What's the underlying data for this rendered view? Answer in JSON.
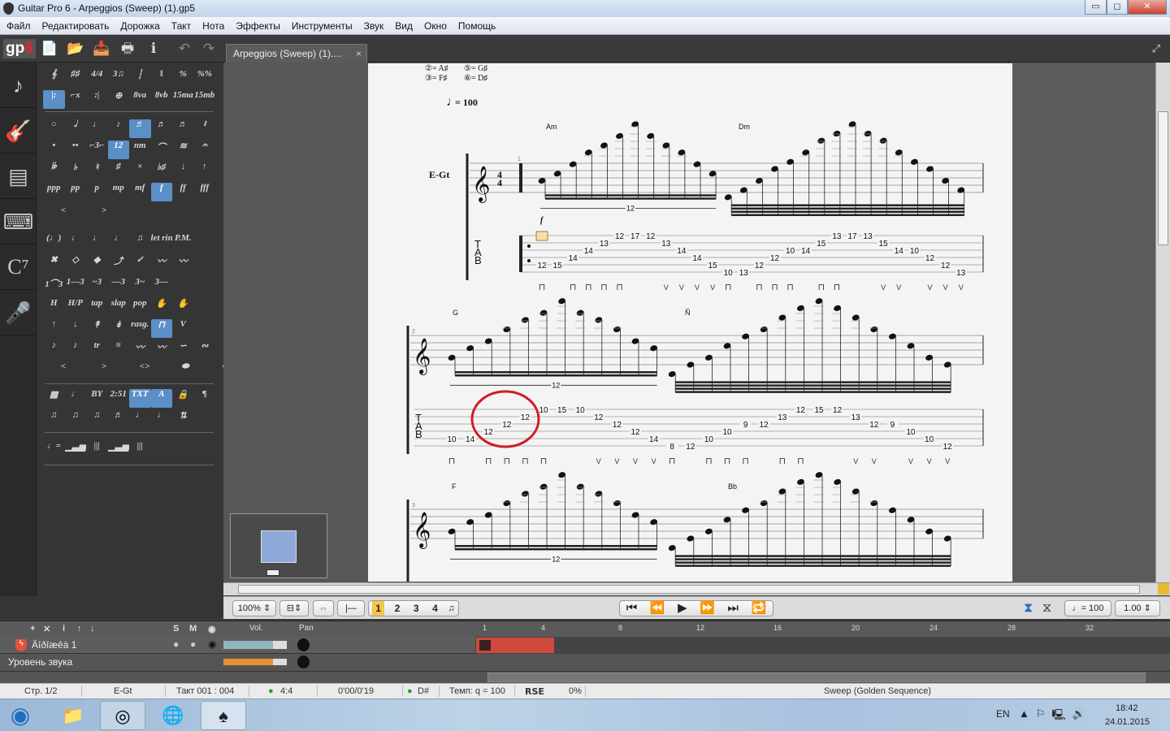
{
  "window": {
    "title": "Guitar Pro 6 - Arpeggios (Sweep) (1).gp5",
    "minimize": "▭",
    "maximize": "◻",
    "close": "✕"
  },
  "menu": [
    "Файл",
    "Редактировать",
    "Дорожка",
    "Такт",
    "Нота",
    "Эффекты",
    "Инструменты",
    "Звук",
    "Вид",
    "Окно",
    "Помощь"
  ],
  "toolbar": {
    "logo": "gp",
    "logo_num": "6",
    "icons": [
      "new-file-icon",
      "open-folder-icon",
      "save-icon",
      "print-icon",
      "info-icon",
      "undo-icon",
      "redo-icon"
    ],
    "glyphs": [
      "📄",
      "📂",
      "📥",
      "🖶",
      "ℹ",
      "↶",
      "↷"
    ],
    "expand": "⤢"
  },
  "doc_tab": {
    "label": "Arpeggios (Sweep) (1)....",
    "close": "×"
  },
  "left_icons": [
    {
      "name": "notation-icon",
      "g": "♪"
    },
    {
      "name": "guitar-icon",
      "g": "🎸"
    },
    {
      "name": "amp-icon",
      "g": "▤"
    },
    {
      "name": "keyboard-icon",
      "g": "⌨"
    },
    {
      "name": "chord-icon",
      "g": "C⁷"
    },
    {
      "name": "microphone-icon",
      "g": "🎤"
    }
  ],
  "palette": [
    [
      {
        "t": "𝄞"
      },
      {
        "t": "♯♯"
      },
      {
        "t": "4/4"
      },
      {
        "t": "3♫"
      },
      {
        "t": "┆"
      },
      {
        "t": "‖"
      },
      {
        "t": "%"
      },
      {
        "t": "%%"
      }
    ],
    [
      {
        "t": "|:",
        "on": true
      },
      {
        "t": "⌐x"
      },
      {
        "t": ":|"
      },
      {
        "t": "⊕"
      },
      {
        "t": "8va"
      },
      {
        "t": "8vb"
      },
      {
        "t": "15ma"
      },
      {
        "t": "15mb"
      }
    ],
    [
      {
        "t": "○"
      },
      {
        "t": "𝅗𝅥"
      },
      {
        "t": "♩"
      },
      {
        "t": "♪"
      },
      {
        "t": "♬",
        "on": true
      },
      {
        "t": "♬"
      },
      {
        "t": "♬"
      },
      {
        "t": "𝄽"
      }
    ],
    [
      {
        "t": "•"
      },
      {
        "t": "••"
      },
      {
        "t": "⌐3⌐"
      },
      {
        "t": "12",
        "on": true
      },
      {
        "t": "nm"
      },
      {
        "t": "⌒"
      },
      {
        "t": "≋"
      },
      {
        "t": "𝄐"
      }
    ],
    [
      {
        "t": "𝄫"
      },
      {
        "t": "♭"
      },
      {
        "t": "♮"
      },
      {
        "t": "♯"
      },
      {
        "t": "×"
      },
      {
        "t": "♭♯"
      },
      {
        "t": "↓"
      },
      {
        "t": "↑"
      }
    ],
    [
      {
        "t": "ppp"
      },
      {
        "t": "pp"
      },
      {
        "t": "p"
      },
      {
        "t": "mp"
      },
      {
        "t": "mf"
      },
      {
        "t": "f",
        "on": true
      },
      {
        "t": "ff"
      },
      {
        "t": "fff"
      }
    ],
    [
      {
        "t": "<"
      },
      {
        "t": ">"
      }
    ],
    [
      {
        "t": "(♩)"
      },
      {
        "t": "♩"
      },
      {
        "t": "♩"
      },
      {
        "t": "♩"
      },
      {
        "t": "♫"
      },
      {
        "t": "let ring"
      },
      {
        "t": "P.M."
      }
    ],
    [
      {
        "t": "✖"
      },
      {
        "t": "◇"
      },
      {
        "t": "◆"
      },
      {
        "t": "⤴"
      },
      {
        "t": "✓"
      },
      {
        "t": "〰"
      },
      {
        "t": "〰"
      }
    ],
    [
      {
        "t": "1⌒3"
      },
      {
        "t": "1—3"
      },
      {
        "t": "~3"
      },
      {
        "t": "—3"
      },
      {
        "t": "3~"
      },
      {
        "t": "3—"
      }
    ],
    [
      {
        "t": "H"
      },
      {
        "t": "H/P"
      },
      {
        "t": "tap"
      },
      {
        "t": "slap"
      },
      {
        "t": "pop"
      },
      {
        "t": "✋"
      },
      {
        "t": "✋"
      }
    ],
    [
      {
        "t": "↑"
      },
      {
        "t": "↓"
      },
      {
        "t": "↟"
      },
      {
        "t": "↡"
      },
      {
        "t": "rasg."
      },
      {
        "t": "⊓",
        "on": true
      },
      {
        "t": "V"
      }
    ],
    [
      {
        "t": "♪"
      },
      {
        "t": "♪"
      },
      {
        "t": "tr"
      },
      {
        "t": "≡"
      },
      {
        "t": "〰"
      },
      {
        "t": "〰"
      },
      {
        "t": "∽"
      },
      {
        "t": "∾"
      }
    ],
    [
      {
        "t": "<"
      },
      {
        "t": ">"
      },
      {
        "t": "<>"
      },
      {
        "t": "⬬"
      },
      {
        "t": "⬬"
      }
    ],
    [
      {
        "t": "▦"
      },
      {
        "t": "♩"
      },
      {
        "t": "BY"
      },
      {
        "t": "2:51"
      },
      {
        "t": "TXT",
        "on": true
      },
      {
        "t": "A",
        "on": true
      },
      {
        "t": "🔒"
      },
      {
        "t": "¶"
      }
    ],
    [
      {
        "t": "♫"
      },
      {
        "t": "♫"
      },
      {
        "t": "♫"
      },
      {
        "t": "♬"
      },
      {
        "t": "♩"
      },
      {
        "t": "♩"
      },
      {
        "t": "⇅"
      }
    ],
    [
      {
        "t": "♩="
      },
      {
        "t": "▁▃▅"
      },
      {
        "t": "|||"
      },
      {
        "t": "▁▃▅"
      },
      {
        "t": "|||"
      }
    ]
  ],
  "score": {
    "tuning": [
      "②= A♯",
      "⑤= G♯",
      "③= F♯",
      "⑥= D♯"
    ],
    "tempo": "= 100",
    "track_label": "E-Gt",
    "dynamic": "f",
    "tuplet": "12",
    "systems": [
      {
        "measure": "1",
        "chords": [
          "Am",
          "Dm"
        ],
        "tab": [
          [
            5,
            "12"
          ],
          [
            5,
            "15"
          ],
          [
            4,
            "14"
          ],
          [
            3,
            "14"
          ],
          [
            2,
            "13"
          ],
          [
            1,
            "12"
          ],
          [
            1,
            "17"
          ],
          [
            1,
            "12"
          ],
          [
            2,
            "13"
          ],
          [
            3,
            "14"
          ],
          [
            4,
            "14"
          ],
          [
            5,
            "15"
          ],
          [
            6,
            "10"
          ],
          [
            6,
            "13"
          ],
          [
            5,
            "12"
          ],
          [
            4,
            "12"
          ],
          [
            3,
            "10"
          ],
          [
            3,
            "14"
          ],
          [
            2,
            "15"
          ],
          [
            1,
            "13"
          ],
          [
            1,
            "17"
          ],
          [
            1,
            "13"
          ],
          [
            2,
            "15"
          ],
          [
            3,
            "14"
          ],
          [
            3,
            "10"
          ],
          [
            4,
            "12"
          ],
          [
            5,
            "12"
          ],
          [
            6,
            "13"
          ]
        ],
        "strokes": [
          "d",
          "",
          "d",
          "d",
          "d",
          "d",
          "",
          "",
          "u",
          "u",
          "u",
          "u",
          "d",
          "",
          "d",
          "d",
          "d",
          "",
          "d",
          "d",
          "",
          "",
          "u",
          "u",
          "",
          "u",
          "u",
          "u"
        ]
      },
      {
        "measure": "2",
        "chords": [
          "G",
          "Ñ"
        ],
        "tab": [
          [
            5,
            "10"
          ],
          [
            5,
            "14"
          ],
          [
            4,
            "12"
          ],
          [
            3,
            "12"
          ],
          [
            2,
            "12"
          ],
          [
            1,
            "10"
          ],
          [
            1,
            "15"
          ],
          [
            1,
            "10"
          ],
          [
            2,
            "12"
          ],
          [
            3,
            "12"
          ],
          [
            4,
            "12"
          ],
          [
            5,
            "14"
          ],
          [
            6,
            "8"
          ],
          [
            6,
            "12"
          ],
          [
            5,
            "10"
          ],
          [
            4,
            "10"
          ],
          [
            3,
            "9"
          ],
          [
            3,
            "12"
          ],
          [
            2,
            "13"
          ],
          [
            1,
            "12"
          ],
          [
            1,
            "15"
          ],
          [
            1,
            "12"
          ],
          [
            2,
            "13"
          ],
          [
            3,
            "12"
          ],
          [
            3,
            "9"
          ],
          [
            4,
            "10"
          ],
          [
            5,
            "10"
          ],
          [
            6,
            "12"
          ]
        ],
        "strokes": [
          "d",
          "",
          "d",
          "d",
          "d",
          "d",
          "",
          "",
          "u",
          "u",
          "u",
          "u",
          "d",
          "",
          "d",
          "d",
          "d",
          "",
          "d",
          "d",
          "",
          "",
          "u",
          "u",
          "",
          "u",
          "u",
          "u"
        ]
      },
      {
        "measure": "3",
        "chords": [
          "F",
          "Bb"
        ]
      }
    ],
    "annotation_color": "#d01c24"
  },
  "bottom_toolbar": {
    "zoom": "100%",
    "page_numbers": [
      "1",
      "2",
      "3",
      "4"
    ],
    "tempo": "= 100",
    "speed": "1.00",
    "transport": [
      "⏮",
      "⏪",
      "▶",
      "⏩",
      "⏭",
      "🔁"
    ]
  },
  "tracks": {
    "header_tools": [
      "+",
      "✕",
      "i",
      "↑",
      "↓"
    ],
    "solo": "S",
    "mute": "M",
    "vol": "Vol.",
    "pan": "Pan",
    "ruler": [
      "1",
      "4",
      "8",
      "12",
      "16",
      "20",
      "24",
      "28",
      "32"
    ],
    "track_name": "Äîðîæêà 1",
    "volume": 0.78,
    "master_name": "Уровень звука",
    "master_volume": 0.78
  },
  "status": {
    "page": "Стр. 1/2",
    "track": "E-Gt",
    "bar": "Такт 001 : 004",
    "time_sig": "4:4",
    "time": "0'00/0'19",
    "key": "D#",
    "tempo": "Темп: q = 100",
    "rse": "RSE",
    "cpu": "0%",
    "song": "Sweep (Golden Sequence)",
    "led_color": "#2ca02c"
  },
  "taskbar": {
    "lang": "EN",
    "time": "18:42",
    "date": "24.01.2015",
    "tray": [
      "▲",
      "⚐",
      "🖳",
      "🔊"
    ]
  }
}
